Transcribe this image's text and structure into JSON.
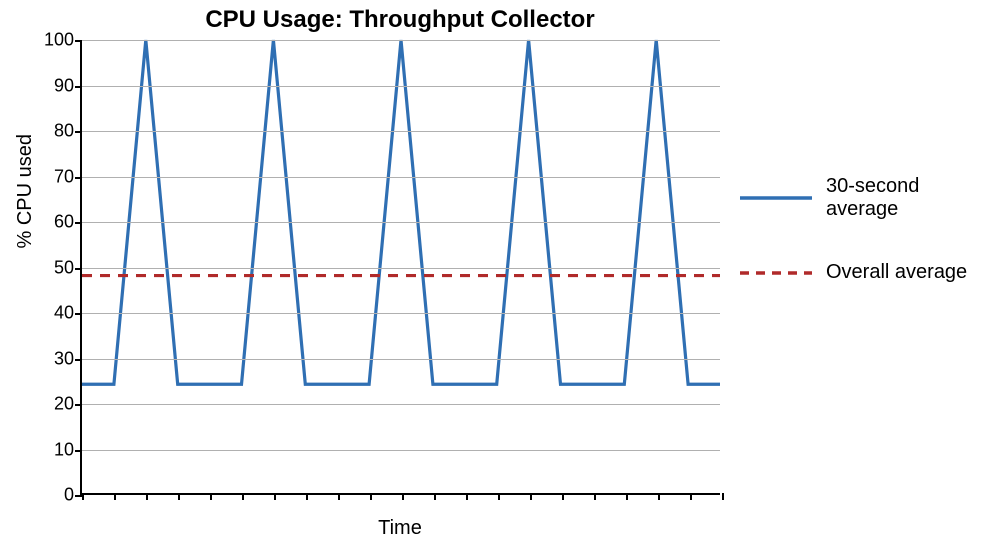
{
  "chart_data": {
    "type": "line",
    "title": "CPU Usage: Throughput Collector",
    "xlabel": "Time",
    "ylabel": "% CPU used",
    "ylim": [
      0,
      100
    ],
    "yticks": [
      0,
      10,
      20,
      30,
      40,
      50,
      60,
      70,
      80,
      90,
      100
    ],
    "x_tick_count": 21,
    "x": [
      0,
      1,
      2,
      3,
      4,
      5,
      6,
      7,
      8,
      9,
      10,
      11,
      12,
      13,
      14,
      15,
      16,
      17,
      18,
      19,
      20
    ],
    "series": [
      {
        "name": "30-second average",
        "color": "#2f6fb3",
        "style": "solid",
        "values": [
          24,
          24,
          100,
          24,
          24,
          24,
          100,
          24,
          24,
          24,
          100,
          24,
          24,
          24,
          100,
          24,
          24,
          24,
          100,
          24,
          24
        ]
      },
      {
        "name": "Overall average",
        "color": "#b02a2a",
        "style": "dashed",
        "values": [
          48,
          48,
          48,
          48,
          48,
          48,
          48,
          48,
          48,
          48,
          48,
          48,
          48,
          48,
          48,
          48,
          48,
          48,
          48,
          48,
          48
        ]
      }
    ]
  },
  "legend": {
    "items": [
      {
        "label": "30-second average"
      },
      {
        "label": "Overall average"
      }
    ]
  }
}
